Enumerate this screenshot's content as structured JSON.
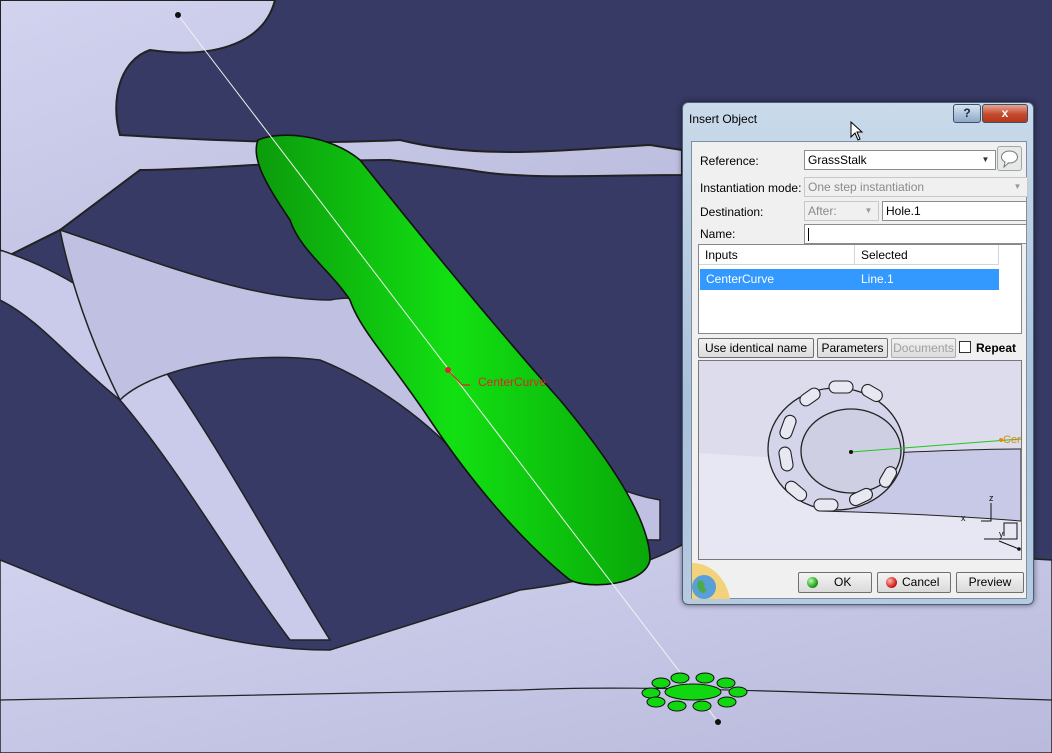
{
  "scene": {
    "annotation_label": "CenterCurve"
  },
  "dialog": {
    "title": "Insert Object",
    "help_label": "?",
    "close_label": "x",
    "reference": {
      "label": "Reference:",
      "value": "GrassStalk"
    },
    "instantiation_mode": {
      "label": "Instantiation mode:",
      "value": "One step instantiation"
    },
    "destination": {
      "label": "Destination:",
      "position": "After:",
      "value": "Hole.1"
    },
    "name": {
      "label": "Name:",
      "value": ""
    },
    "table": {
      "columns": [
        "Inputs",
        "Selected"
      ],
      "rows": [
        {
          "input": "CenterCurve",
          "selected": "Line.1"
        }
      ]
    },
    "buttons": {
      "use_identical_name": "Use identical name",
      "parameters": "Parameters",
      "documents": "Documents",
      "repeat": "Repeat"
    },
    "preview_label": "Cen",
    "axes": {
      "x": "x",
      "y": "y",
      "z": "z"
    },
    "footer": {
      "ok": "OK",
      "cancel": "Cancel",
      "preview": "Preview"
    }
  },
  "colors": {
    "background": "#363a64",
    "surface": "#c9cae8",
    "highlight_green": "#10d710",
    "selection_blue": "#3399ff",
    "annotation_red": "#e0232a"
  }
}
